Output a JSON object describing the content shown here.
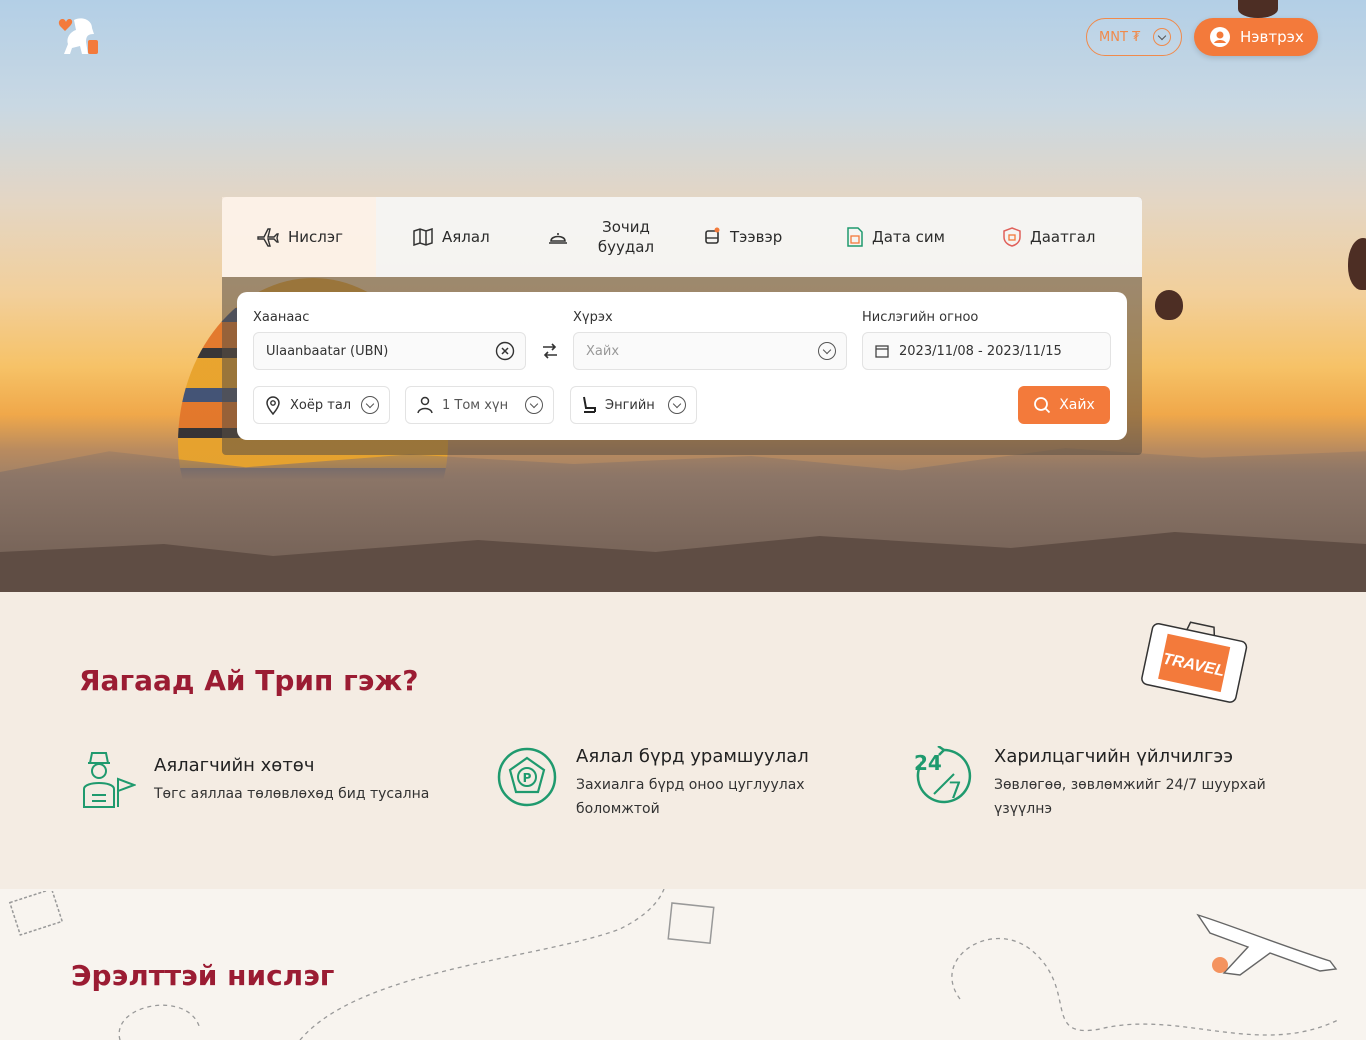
{
  "header": {
    "currency": "MNT ₮",
    "login_label": "Нэвтрэх"
  },
  "tabs": [
    {
      "label": "Нислэг",
      "icon": "plane-icon",
      "active": true
    },
    {
      "label": "Аялал",
      "icon": "map-icon"
    },
    {
      "label": "Зочид буудал",
      "icon": "hotel-bell-icon"
    },
    {
      "label": "Тээвэр",
      "icon": "bus-icon"
    },
    {
      "label": "Дата сим",
      "icon": "sim-icon"
    },
    {
      "label": "Даатгал",
      "icon": "shield-icon"
    }
  ],
  "search": {
    "from_label": "Хаанаас",
    "from_value": "Ulaanbaatar (UBN)",
    "to_label": "Хүрэх",
    "to_placeholder": "Хайх",
    "date_label": "Нислэгийн огноо",
    "date_value": "2023/11/08 - 2023/11/15",
    "trip_type": "Хоёр тал",
    "passengers": "1 Том хүн",
    "cabin_class": "Энгийн",
    "search_label": "Хайх"
  },
  "why": {
    "title": "Яагаад Ай Трип гэж?",
    "features": [
      {
        "title": "Аялагчийн хөтөч",
        "desc": "Төгс аяллаа төлөвлөхөд бид тусална",
        "icon": "guide-icon"
      },
      {
        "title": "Аялал бүрд урамшуулал",
        "desc": "Захиалга бүрд оноо цуглуулах боломжтой",
        "icon": "points-badge-icon"
      },
      {
        "title": "Харилцагчийн үйлчилгээ",
        "desc": "Зөвлөгөө, зөвлөмжийг 24/7 шуурхай үзүүлнэ",
        "icon": "support-24-7-icon"
      }
    ],
    "suitcase_text": "TRAVEL"
  },
  "popular": {
    "title": "Эрэлттэй нислэг"
  },
  "colors": {
    "accent": "#f37a3b",
    "title": "#9b1c33",
    "teal": "#1f9a6e"
  }
}
